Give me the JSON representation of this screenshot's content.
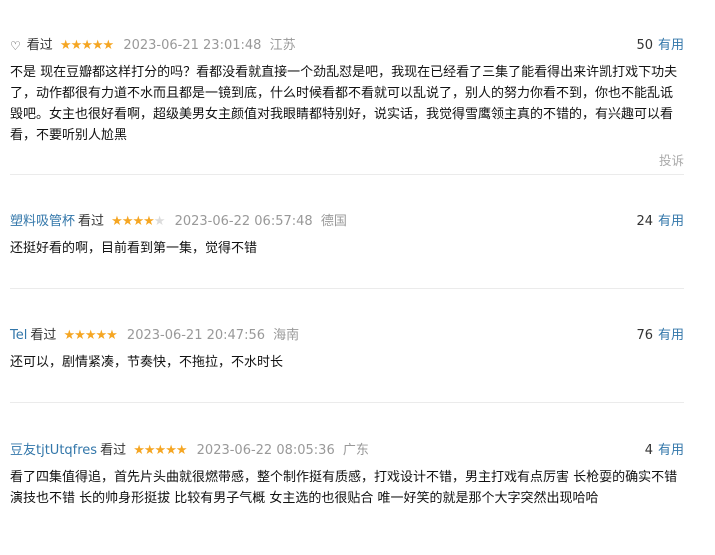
{
  "reviews": [
    {
      "user": "",
      "user_icon": "heart-outline-icon",
      "status": "看过",
      "rating": 5,
      "time": "2023-06-21 23:01:48",
      "location": "江苏",
      "votes": "50",
      "vote_label": "有用",
      "content": "不是 现在豆瓣都这样打分的吗？看都没看就直接一个劲乱怼是吧，我现在已经看了三集了能看得出来许凯打戏下功夫了，动作都很有力道不水而且都是一镜到底，什么时候看都不看就可以乱说了，别人的努力你看不到，你也不能乱诋毁吧。女主也很好看啊，超级美男女主颜值对我眼睛都特别好，说实话，我觉得雪鹰领主真的不错的，有兴趣可以看看，不要听别人尬黑",
      "report_label": "投诉"
    },
    {
      "user": "塑料吸管杯",
      "status": "看过",
      "rating": 4,
      "time": "2023-06-22 06:57:48",
      "location": "德国",
      "votes": "24",
      "vote_label": "有用",
      "content": "还挺好看的啊，目前看到第一集，觉得不错"
    },
    {
      "user": "Tel",
      "status": "看过",
      "rating": 5,
      "time": "2023-06-21 20:47:56",
      "location": "海南",
      "votes": "76",
      "vote_label": "有用",
      "content": "还可以，剧情紧凑，节奏快，不拖拉，不水时长"
    },
    {
      "user": "豆友tjtUtqfres",
      "status": "看过",
      "rating": 5,
      "time": "2023-06-22 08:05:36",
      "location": "广东",
      "votes": "4",
      "vote_label": "有用",
      "content": "看了四集值得追，首先片头曲就很燃带感，整个制作挺有质感，打戏设计不错，男主打戏有点厉害 长枪耍的确实不错 演技也不错 长的帅身形挺拔 比较有男子气概 女主选的也很贴合 唯一好笑的就是那个大字突然出现哈哈"
    }
  ],
  "colors": {
    "link": "#3377aa",
    "star_on": "#f5a623",
    "star_off": "#dcdcdc",
    "meta_gray": "#999999"
  }
}
